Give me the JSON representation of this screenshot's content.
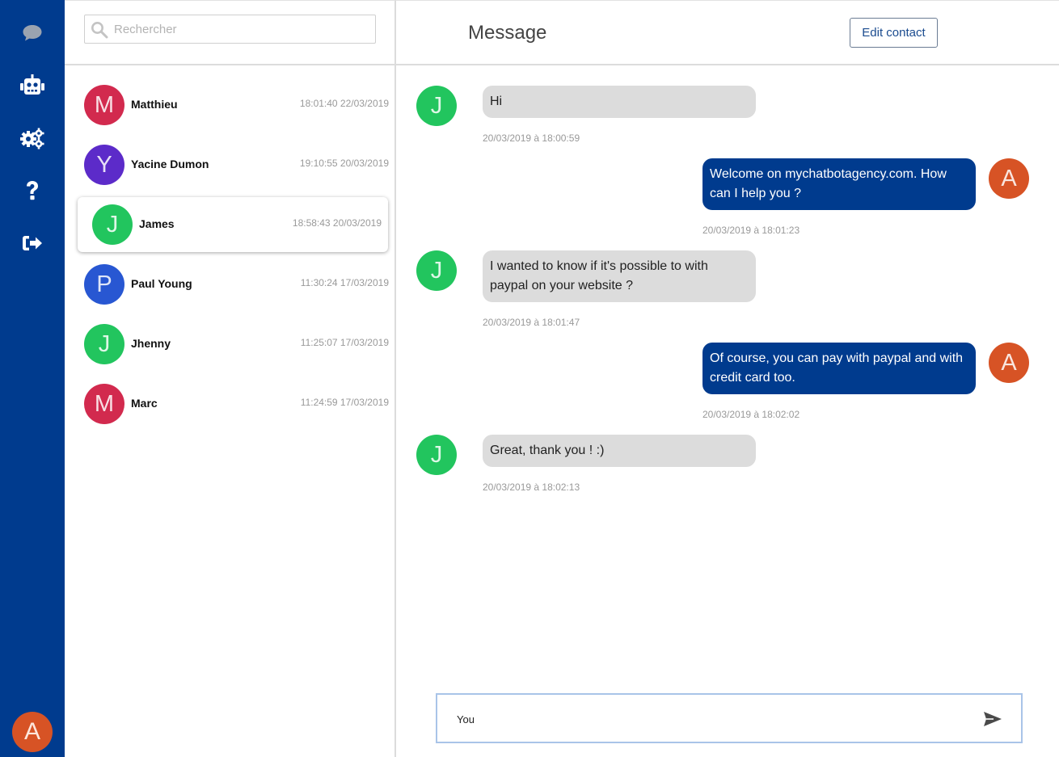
{
  "nav": {
    "items": [
      {
        "icon": "chat-bubble-icon",
        "label": "Messages"
      },
      {
        "icon": "robot-icon",
        "label": "Bot"
      },
      {
        "icon": "gears-icon",
        "label": "Settings"
      },
      {
        "icon": "question-icon",
        "label": "Help"
      },
      {
        "icon": "sign-out-icon",
        "label": "Logout"
      }
    ],
    "user_avatar": "A"
  },
  "search": {
    "placeholder": "Rechercher"
  },
  "contacts": [
    {
      "initial": "M",
      "name": "Matthieu",
      "time": "18:01:40 22/03/2019",
      "color": "#d22a4e"
    },
    {
      "initial": "Y",
      "name": "Yacine Dumon",
      "time": "19:10:55 20/03/2019",
      "color": "#5c2bc9"
    },
    {
      "initial": "J",
      "name": "James",
      "time": "18:58:43 20/03/2019",
      "color": "#22c55e",
      "active": true
    },
    {
      "initial": "P",
      "name": "Paul Young",
      "time": "11:30:24 17/03/2019",
      "color": "#2857d2"
    },
    {
      "initial": "J",
      "name": "Jhenny",
      "time": "11:25:07 17/03/2019",
      "color": "#22c55e"
    },
    {
      "initial": "M",
      "name": "Marc",
      "time": "11:24:59 17/03/2019",
      "color": "#d22a4e"
    }
  ],
  "chat": {
    "title": "Message",
    "edit_label": "Edit contact",
    "messages": [
      {
        "from": "contact",
        "initial": "J",
        "text": "Hi",
        "time": "20/03/2019 à 18:00:59"
      },
      {
        "from": "agent",
        "initial": "A",
        "text": "Welcome on mychatbotagency.com. How can I help you ?",
        "time": "20/03/2019 à 18:01:23"
      },
      {
        "from": "contact",
        "initial": "J",
        "text": "I wanted to know if it's possible to with paypal on your website ?",
        "time": "20/03/2019 à 18:01:47"
      },
      {
        "from": "agent",
        "initial": "A",
        "text": "Of course, you can pay with paypal and with credit card too.",
        "time": "20/03/2019 à 18:02:02"
      },
      {
        "from": "contact",
        "initial": "J",
        "text": "Great, thank you ! :)",
        "time": "20/03/2019 à 18:02:13"
      }
    ],
    "composer_value": "You",
    "colors": {
      "contact_avatar": "#22c55e",
      "agent_avatar": "#d75325",
      "agent_bubble": "#003b8e",
      "contact_bubble": "#dcdcdc"
    }
  }
}
